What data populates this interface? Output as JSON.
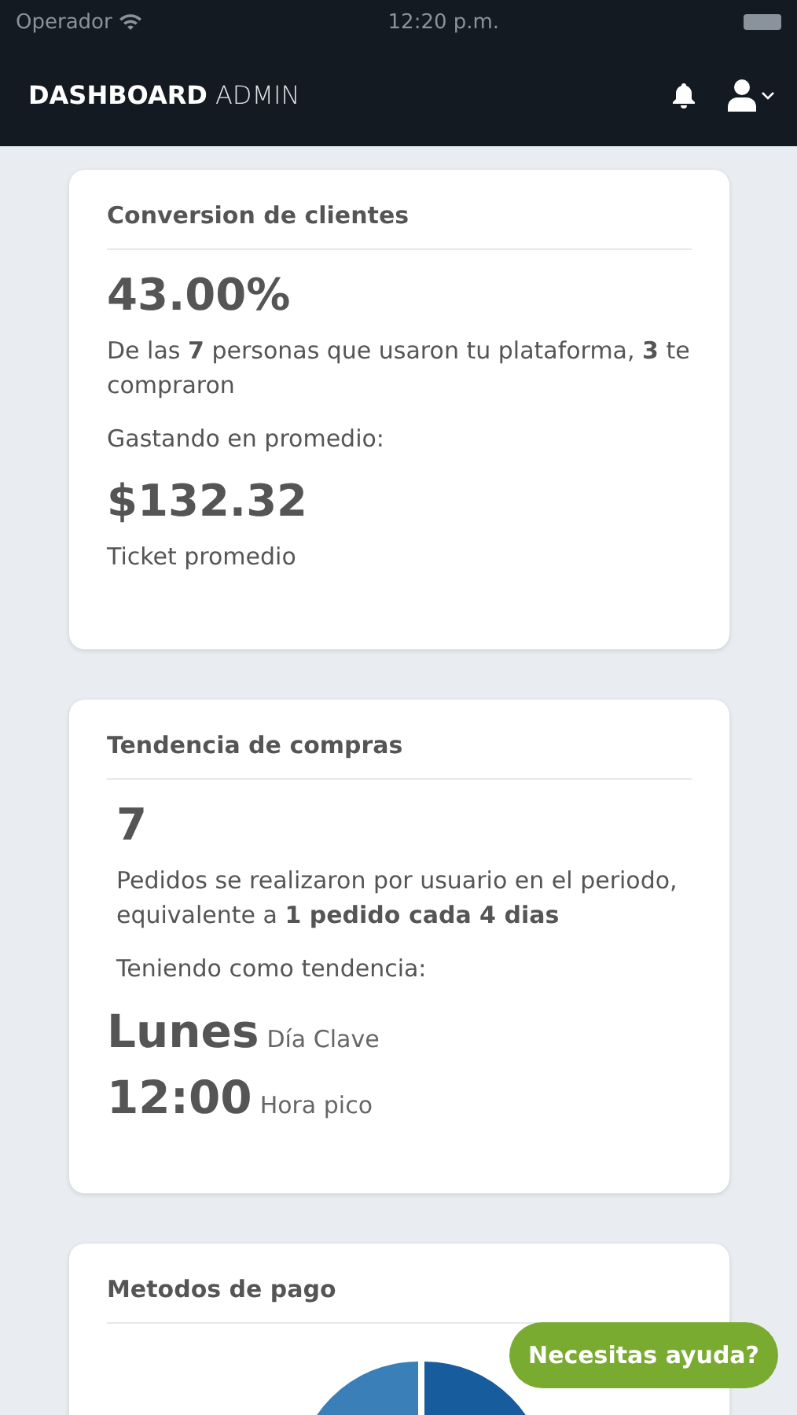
{
  "status_bar": {
    "carrier": "Operador",
    "time": "12:20 p.m."
  },
  "navbar": {
    "title_bold": "DASHBOARD",
    "title_light": "ADMIN"
  },
  "conversion_card": {
    "title": "Conversion de clientes",
    "percent": "43.00%",
    "description": "De las **7** personas que usaron tu plataforma, **3** te compraron",
    "spend_label": "Gastando en promedio:",
    "amount": "$132.32",
    "amount_caption": "Ticket promedio"
  },
  "trend_card": {
    "title": "Tendencia de compras",
    "count": "7",
    "description": "Pedidos se realizaron por usuario en el periodo, equivalente a **1 pedido cada 4 dias**",
    "trend_label": "Teniendo como tendencia:",
    "highlights": [
      {
        "value": "Lunes",
        "caption": "Día Clave"
      },
      {
        "value": "12:00",
        "caption": "Hora pico"
      }
    ]
  },
  "payment_card": {
    "title": "Metodos de pago"
  },
  "help_button": {
    "label": "Necesitas ayuda?"
  }
}
